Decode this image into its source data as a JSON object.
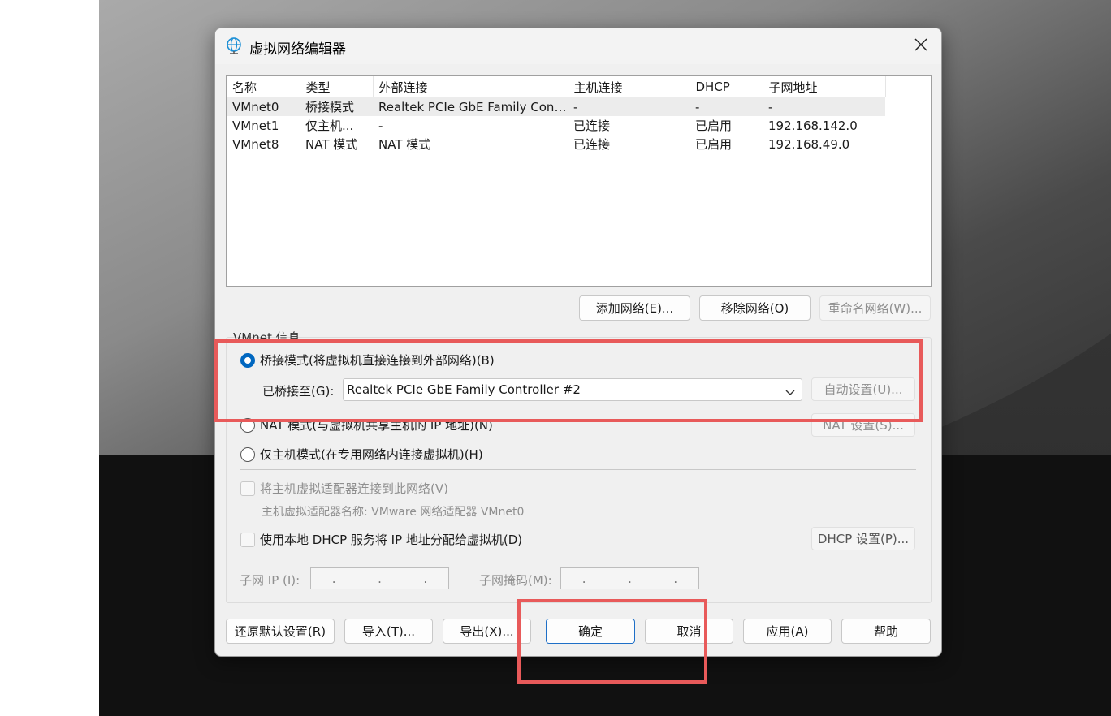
{
  "dialog": {
    "title": "虚拟网络编辑器",
    "close_symbol": "✕"
  },
  "network_table": {
    "columns": [
      "名称",
      "类型",
      "外部连接",
      "主机连接",
      "DHCP",
      "子网地址"
    ],
    "rows": [
      [
        "VMnet0",
        "桥接模式",
        "Realtek PCIe GbE Family Cont...",
        "-",
        "-",
        "-"
      ],
      [
        "VMnet1",
        "仅主机...",
        "-",
        "已连接",
        "已启用",
        "192.168.142.0"
      ],
      [
        "VMnet8",
        "NAT 模式",
        "NAT 模式",
        "已连接",
        "已启用",
        "192.168.49.0"
      ]
    ],
    "selected_row": 0
  },
  "list_buttons": {
    "add": "添加网络(E)...",
    "remove": "移除网络(O)",
    "rename": "重命名网络(W)..."
  },
  "vmnet_info": {
    "group_label": "VMnet 信息",
    "bridged_label": "桥接模式(将虚拟机直接连接到外部网络)(B)",
    "bridged_to_label": "已桥接至(G):",
    "bridged_to_value": "Realtek PCIe GbE Family Controller #2",
    "auto_settings": "自动设置(U)...",
    "nat_label": "NAT 模式(与虚拟机共享主机的 IP 地址)(N)",
    "nat_settings": "NAT 设置(S)...",
    "hostonly_label": "仅主机模式(在专用网络内连接虚拟机)(H)",
    "connect_adapter_label": "将主机虚拟适配器连接到此网络(V)",
    "adapter_name_label": "主机虚拟适配器名称: VMware 网络适配器 VMnet0",
    "dhcp_label": "使用本地 DHCP 服务将 IP 地址分配给虚拟机(D)",
    "dhcp_settings": "DHCP 设置(P)...",
    "subnet_ip_label": "子网 IP (I):",
    "subnet_mask_label": "子网掩码(M):",
    "ip_dot": "."
  },
  "footer": {
    "restore": "还原默认设置(R)",
    "import": "导入(T)...",
    "export": "导出(X)...",
    "ok": "确定",
    "cancel": "取消",
    "apply": "应用(A)",
    "help": "帮助"
  },
  "colors": {
    "accent": "#0067c0",
    "highlight": "#e85a5a"
  },
  "icons": {
    "title": "network-globe-icon",
    "close": "close-icon",
    "dropdown": "chevron-down-icon"
  }
}
